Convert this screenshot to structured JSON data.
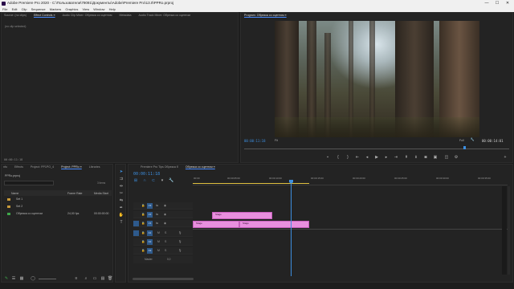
{
  "window": {
    "title": "Adobe Premiere Pro 2020 - C:\\Пользователи\\79091\\Документы\\Adobe\\Premiere Pro\\13.0\\PPRo.prproj",
    "minimize": "—",
    "maximize": "☐",
    "close": "✕"
  },
  "menu": [
    "File",
    "Edit",
    "Clip",
    "Sequence",
    "Markers",
    "Graphics",
    "View",
    "Window",
    "Help"
  ],
  "source_panel": {
    "tabs": [
      "Source: (no clips)",
      "Effect Controls ≡",
      "Audio Clip Mixer: Обрезка со сцентом",
      "Metadata",
      "Audio Track Mixer: Обрезка со сцентом"
    ],
    "empty_text": "(no clip selected)",
    "timecode": "00:00:11:18"
  },
  "program_panel": {
    "title": "Program: Обрезка со сцентом ≡",
    "timecode": "00:00:11:18",
    "fit": "Fit",
    "quality": "Full",
    "duration": "00:00:14:01"
  },
  "project_panel": {
    "tabs": [
      "nfo",
      "Effects",
      "Project: PP1PO_4",
      "Project: PPRo ≡",
      "Libraries"
    ],
    "file": "PPRo.prproj",
    "item_count": "3 items",
    "headers": [
      "Name",
      "Frame Rate",
      "Media Start"
    ],
    "rows": [
      {
        "name": "Set 1",
        "rate": "",
        "start": ""
      },
      {
        "name": "Set 2",
        "rate": "",
        "start": ""
      },
      {
        "name": "Обрезка со сцентом",
        "rate": "24,00 fps",
        "start": "00:00:00:00"
      }
    ]
  },
  "timeline": {
    "tabs": [
      "Premiere Pro Tips Обрезка б",
      "Обрезка со сцентом ≡"
    ],
    "timecode": "00:00:11:18",
    "ruler": [
      "00:00",
      "00:00:05:00",
      "00:00:10:00",
      "00:00:15:00",
      "00:00:20:00",
      "00:00:25:00",
      "00:00:30:00",
      "00:00:35:00"
    ],
    "video_tracks": [
      "V3",
      "V2",
      "V1"
    ],
    "audio_tracks": [
      "A1",
      "A2",
      "A3"
    ],
    "master_label": "Master",
    "master_value": "0,0",
    "clips": [
      {
        "track": "V2",
        "label": "Stage"
      },
      {
        "track": "V1",
        "label": "Stage"
      },
      {
        "track": "V1",
        "label": "Stage"
      }
    ]
  },
  "colors": {
    "accent": "#3d8fe0",
    "clip": "#e88fde",
    "panel": "#232323"
  }
}
